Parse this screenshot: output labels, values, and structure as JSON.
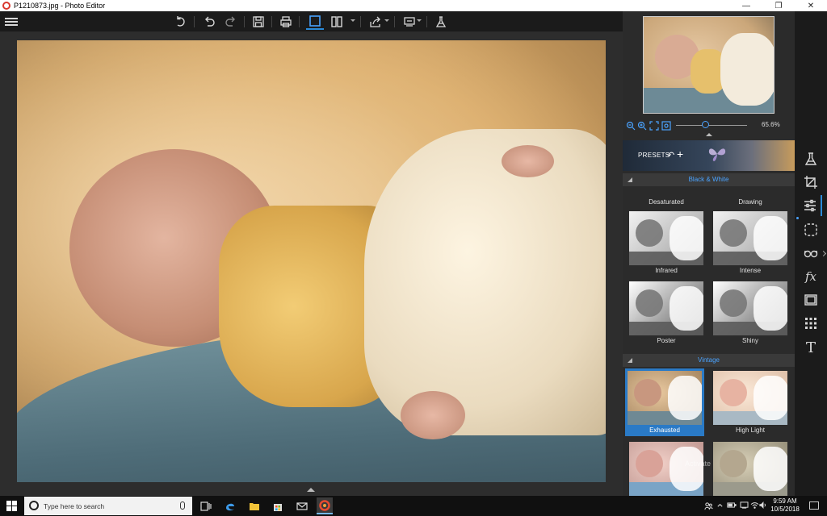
{
  "window": {
    "title": "P1210873.jpg - Photo Editor",
    "controls": {
      "minimize": "—",
      "maximize": "❐",
      "close": "✕"
    }
  },
  "toolbar": {
    "items": [
      "menu-icon",
      "rotate-left-icon",
      "undo-icon",
      "redo-icon",
      "save-icon",
      "print-icon",
      "single-view-icon",
      "compare-view-icon",
      "share-icon",
      "batch-icon",
      "lab-icon"
    ],
    "active": "single-view-icon",
    "accent": "#2a8ad8"
  },
  "navigator": {
    "zoom_percent": "65.6%",
    "zoom_level": 0.42
  },
  "presets": {
    "label": "PRESETS",
    "undo_glyph": "↶",
    "add_glyph": "+"
  },
  "sections": {
    "black_white": {
      "title": "Black & White",
      "items": [
        "Desaturated",
        "Drawing",
        "Infrared",
        "Intense",
        "Poster",
        "Shiny"
      ]
    },
    "vintage": {
      "title": "Vintage",
      "items": [
        "Exhausted",
        "High Light"
      ],
      "selected": "Exhausted"
    }
  },
  "watermark": "Activate",
  "tools": [
    "lab-icon",
    "crop-icon",
    "adjust-icon",
    "selection-icon",
    "glasses-icon",
    "fx-icon",
    "frame-icon",
    "texture-icon",
    "text-icon"
  ],
  "tool_glyphs": {
    "fx": "fx",
    "text": "T"
  },
  "active_tool": "adjust-icon",
  "taskbar": {
    "search_placeholder": "Type here to search",
    "time": "9:59 AM",
    "date": "10/5/2018"
  }
}
